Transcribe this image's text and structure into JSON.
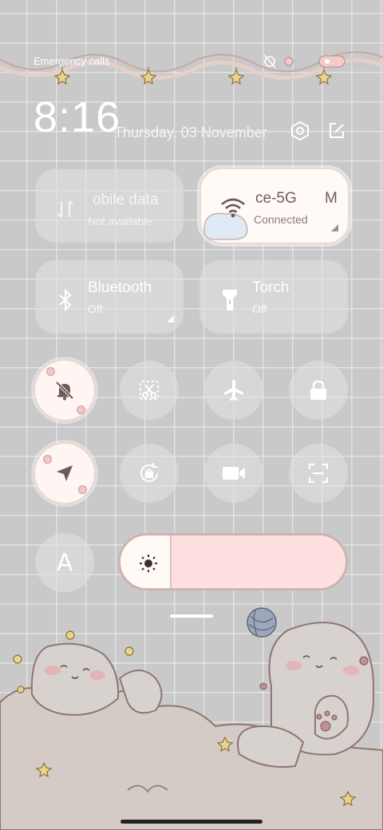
{
  "status_bar": {
    "carrier_text": "Emergency calls",
    "icons": [
      "alarm-off-icon",
      "notification-icon",
      "battery-icon"
    ]
  },
  "header": {
    "time": "8:16",
    "date": "Thursday, 03 November",
    "settings_icon": "settings-hex-icon",
    "edit_icon": "edit-icon"
  },
  "tiles": {
    "mobile_data": {
      "title": "obile data",
      "subtitle": "Not available",
      "icon": "mobile-data-arrows-icon",
      "active": false
    },
    "wifi": {
      "title": "ce-5G",
      "title_trailing": "M",
      "subtitle": "Connected",
      "icon": "wifi-icon",
      "active": true
    },
    "bluetooth": {
      "title": "Bluetooth",
      "subtitle": "Off",
      "icon": "bluetooth-icon",
      "active": false
    },
    "torch": {
      "title": "Torch",
      "subtitle": "Off",
      "icon": "torch-icon",
      "active": false
    }
  },
  "toggles": [
    {
      "name": "silent",
      "icon": "bell-off-icon",
      "active": true
    },
    {
      "name": "screenshot",
      "icon": "scissors-icon",
      "active": false
    },
    {
      "name": "airplane",
      "icon": "airplane-icon",
      "active": false
    },
    {
      "name": "lock",
      "icon": "lock-icon",
      "active": false
    },
    {
      "name": "location",
      "icon": "location-arrow-icon",
      "active": true
    },
    {
      "name": "auto-rotate",
      "icon": "rotate-lock-icon",
      "active": false
    },
    {
      "name": "screen-record",
      "icon": "video-camera-icon",
      "active": false
    },
    {
      "name": "scanner",
      "icon": "scan-frame-icon",
      "active": false
    },
    {
      "name": "font",
      "label": "A",
      "icon": "font-icon",
      "active": false
    }
  ],
  "brightness": {
    "level": 0.22,
    "icon": "sun-icon"
  },
  "colors": {
    "accent_pink": "#ffe0e0",
    "tile_bg": "#e1e1e1",
    "cat_outline": "#8d7772"
  }
}
